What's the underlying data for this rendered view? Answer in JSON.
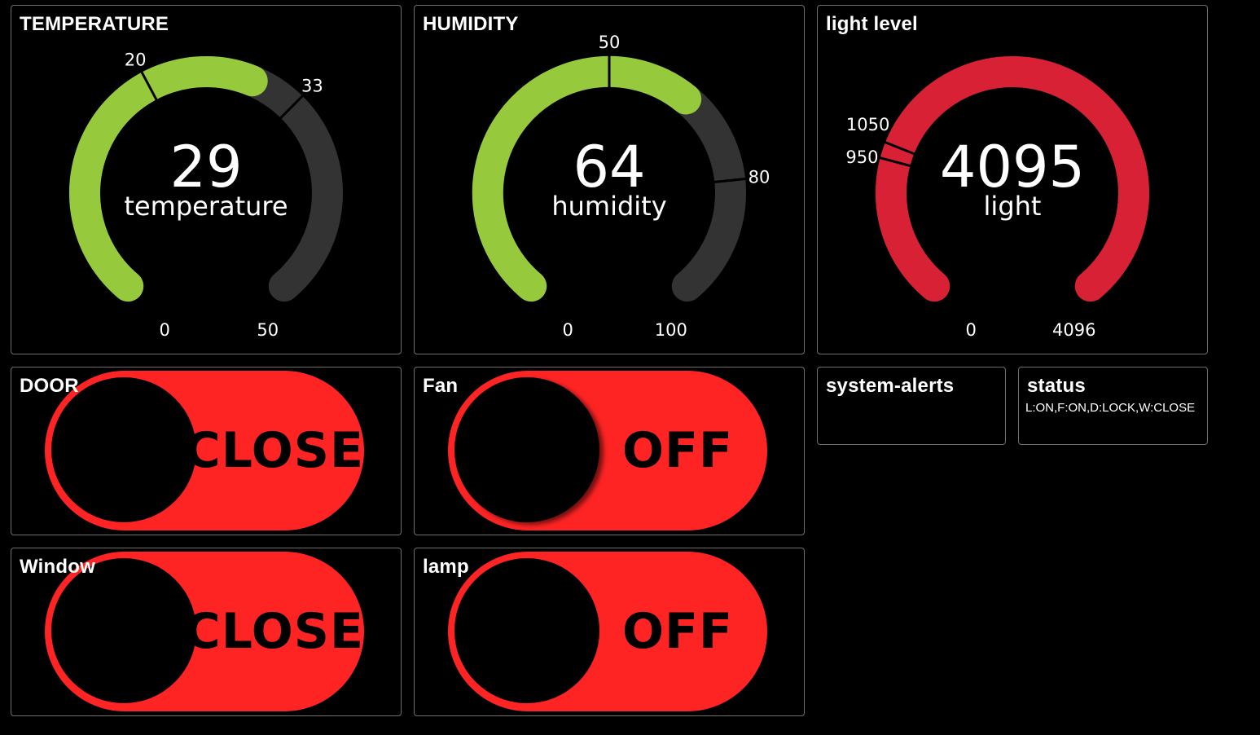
{
  "temperature": {
    "title": "TEMPERATURE",
    "value": "29",
    "label": "temperature",
    "min": "0",
    "max": "50",
    "marker_low": "20",
    "marker_high": "33",
    "level": 0.58,
    "color": "#97c93d"
  },
  "humidity": {
    "title": "HUMIDITY",
    "value": "64",
    "label": "humidity",
    "min": "0",
    "max": "100",
    "marker_low": "50",
    "marker_high": "80",
    "level": 0.64,
    "color": "#97c93d"
  },
  "light": {
    "title": "light level",
    "value": "4095",
    "label": "light",
    "min": "0",
    "max": "4096",
    "marker_low": "950",
    "marker_high": "1050",
    "level": 1.0,
    "color": "#d92135"
  },
  "door": {
    "title": "DOOR",
    "state": "CLOSE"
  },
  "fan": {
    "title": "Fan",
    "state": "OFF"
  },
  "window": {
    "title": "Window",
    "state": "CLOSE"
  },
  "lamp": {
    "title": "lamp",
    "state": "OFF"
  },
  "system_alerts": {
    "title": "system-alerts",
    "value": ""
  },
  "status": {
    "title": "status",
    "value": "L:ON,F:ON,D:LOCK,W:CLOSE"
  },
  "colors": {
    "background": "#000000",
    "tile_border": "#6e6e6e",
    "gauge_ok": "#97c93d",
    "gauge_alert": "#d92135",
    "gauge_track": "#333333",
    "toggle_off": "#ff2424"
  }
}
